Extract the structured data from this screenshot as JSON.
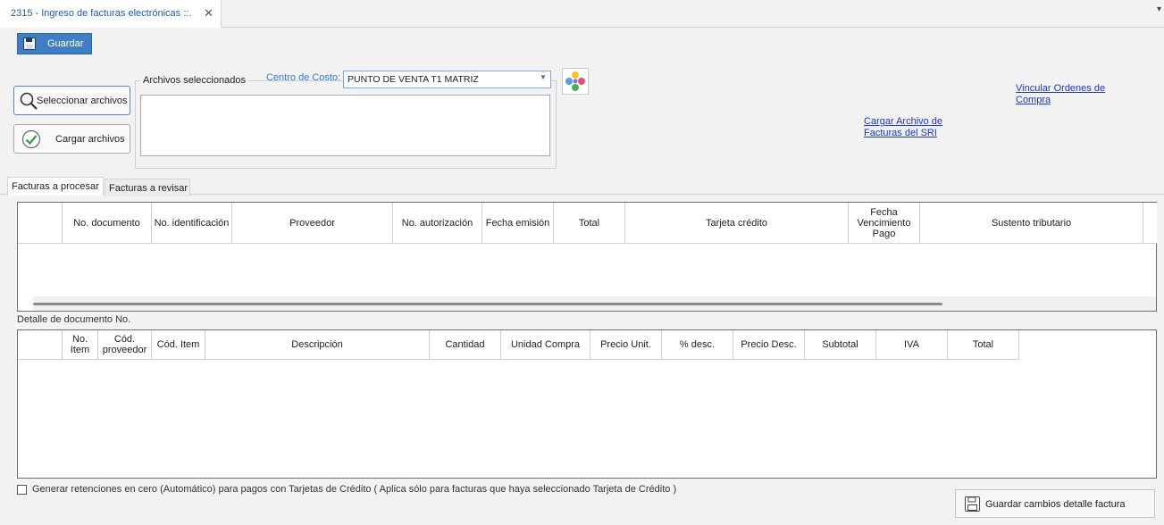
{
  "tab": {
    "title": "2315 - Ingreso de facturas electrónicas ::.",
    "close_icon": "close-icon"
  },
  "toolbar": {
    "save_label": "Guardar"
  },
  "files": {
    "select_label": "Seleccionar archivos",
    "load_label": "Cargar archivos",
    "group_title": "Archivos seleccionados"
  },
  "cost_center": {
    "label": "Centro de Costo:",
    "value": "PUNTO DE VENTA T1 MATRIZ"
  },
  "links": {
    "sri_line1": "Cargar Archivo de",
    "sri_line2": "Facturas del SRI",
    "oc_line1": "Vincular Ordenes de",
    "oc_line2": "Compra"
  },
  "tabs": [
    {
      "label": "Facturas a procesar",
      "active": true
    },
    {
      "label": "Facturas a revisar",
      "active": false
    }
  ],
  "invoices_grid": {
    "columns": [
      "",
      "No. documento",
      "No. identificación",
      "Proveedor",
      "No. autorización",
      "Fecha emisión",
      "Total",
      "Tarjeta crédito",
      "Fecha Vencimiento Pago",
      "Sustento tributario",
      ""
    ],
    "rows": []
  },
  "detail": {
    "label": "Detalle de documento No.",
    "columns": [
      "",
      "No. Item",
      "Cód. proveedor",
      "Cód. Item",
      "Descripción",
      "Cantidad",
      "Unidad Compra",
      "Precio Unit.",
      "% desc.",
      "Precio Desc.",
      "Subtotal",
      "IVA",
      "Total"
    ],
    "rows": []
  },
  "retenciones": {
    "checked": false,
    "label": "Generar retenciones en cero (Automático) para pagos con Tarjetas de Crédito ( Aplica sólo para facturas que haya seleccionado Tarjeta de Crédito )"
  },
  "save_detail": {
    "label": "Guardar cambios detalle factura"
  },
  "colors": {
    "accent": "#3f7ec3",
    "link": "#1d35c8",
    "label_blue": "#2f7bd1"
  }
}
